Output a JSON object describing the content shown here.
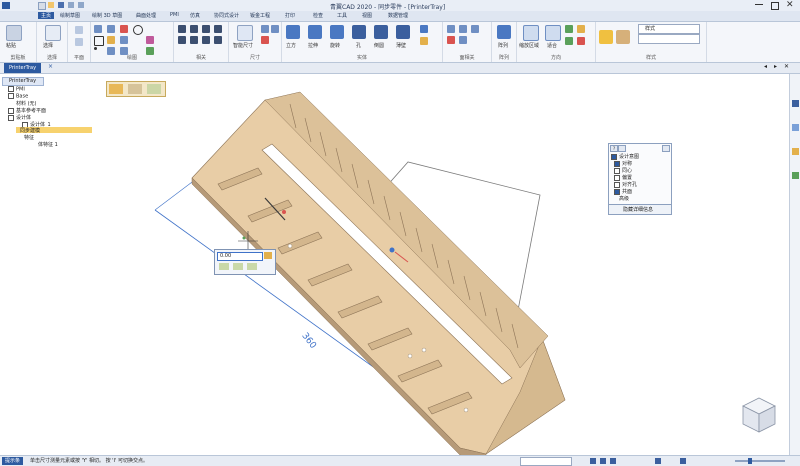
{
  "window": {
    "title": "青翼CAD 2020 - 同步零件 - [PrinterTray]",
    "controls": [
      "minimize",
      "maximize",
      "close"
    ],
    "colors": {
      "accent": "#2d5aa0",
      "part": "#e8cda6",
      "part_dark": "#b69a78"
    }
  },
  "menu": {
    "tabs": [
      "主页",
      "绘制草图",
      "绘制 3D 草图",
      "曲面处理",
      "PMI",
      "仿真",
      "协同式设计",
      "钣金工程",
      "打印",
      "检查",
      "工具",
      "视图",
      "数据管理"
    ]
  },
  "ribbon": {
    "groups": {
      "clipboard": "剪贴板",
      "select": "选择",
      "plane": "平面",
      "draw": "绘图",
      "relate": "相关",
      "dimension": "尺寸",
      "solid": "实体",
      "pattern": "面相关",
      "model": "阵列",
      "direction": "方向",
      "style": "样式"
    },
    "buttons": {
      "paste": "粘贴",
      "select": "选择",
      "smart_dimension": "智能尺寸",
      "extrude": "拉伸",
      "revolve": "旋转",
      "hole": "孔",
      "round": "倒圆",
      "thin": "薄壁",
      "box": "立方",
      "pattern": "阵列",
      "zoom_area": "缩放区域",
      "fit": "适合",
      "style_label": "样式"
    }
  },
  "document": {
    "tab_label": "PrinterTray"
  },
  "tree": {
    "root": "PrinterTray",
    "items": [
      {
        "label": "PMI"
      },
      {
        "label": "Base"
      },
      {
        "label": "材料 (无)"
      },
      {
        "label": "基本参考平面"
      },
      {
        "label": "设计体"
      },
      {
        "label": "设计体_1"
      },
      {
        "label": "同步建模"
      },
      {
        "label": "特征"
      },
      {
        "label": "体特征 1"
      }
    ]
  },
  "dimension": {
    "value_label": "360",
    "input_value": "0.00"
  },
  "design_intent": {
    "items": [
      {
        "label": "设计意图",
        "checked": true
      },
      {
        "label": "对称",
        "checked": true
      },
      {
        "label": "同心",
        "checked": false
      },
      {
        "label": "偏置",
        "checked": false
      },
      {
        "label": "对齐孔",
        "checked": false
      },
      {
        "label": "共面",
        "checked": true
      },
      {
        "label": "高级",
        "checked": false
      }
    ],
    "footer": "隐藏详细信息"
  },
  "status": {
    "tab_label": "提示条",
    "message": "单击尺寸测量元素或按 'Y' 相切。 按 'I' 可切换交点。"
  }
}
